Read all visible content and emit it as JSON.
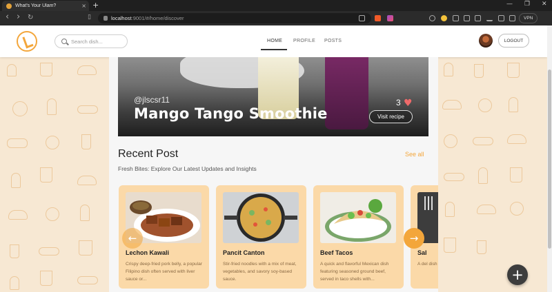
{
  "browser": {
    "tab_title": "What's Your Ulam?",
    "tab_close": "×",
    "new_tab": "+",
    "url_host": "localhost",
    "url_path": ":9001/#/home/discover",
    "vpn_label": "VPN",
    "window_minimize": "—",
    "window_maximize": "❐",
    "window_close": "✕",
    "back": "‹",
    "forward": "›",
    "reload": "↻"
  },
  "header": {
    "search_placeholder": "Search dish...",
    "nav": [
      {
        "label": "HOME",
        "active": true
      },
      {
        "label": "PROFILE",
        "active": false
      },
      {
        "label": "POSTS",
        "active": false
      }
    ],
    "logout_label": "LOGOUT"
  },
  "featured": {
    "username": "@jlscsr11",
    "title": "Mango Tango Smoothie",
    "likes": "3",
    "heart": "♥",
    "visit_label": "Visit recipe"
  },
  "recent": {
    "title": "Recent Post",
    "see_all": "See all",
    "subtitle": "Fresh Bites: Explore Our Latest Updates and Insights",
    "prev_arrow": "←",
    "next_arrow": "→",
    "cards": [
      {
        "name": "Lechon Kawali",
        "desc": "Crispy deep-fried pork belly, a popular Filipino dish often served with liver sauce or..."
      },
      {
        "name": "Pancit Canton",
        "desc": "Stir-fried noodles with a mix of meat, vegetables, and savory soy-based sauce."
      },
      {
        "name": "Beef Tacos",
        "desc": "A quick and flavorful Mexican dish featuring seasoned ground beef, served in taco shells with..."
      },
      {
        "name": "Sal",
        "desc": "A del dish t glaze"
      }
    ]
  },
  "fab_label": "+",
  "colors": {
    "accent": "#f3a63b",
    "card_bg": "#fbd9a8",
    "page_bg": "#f7e8d3"
  }
}
